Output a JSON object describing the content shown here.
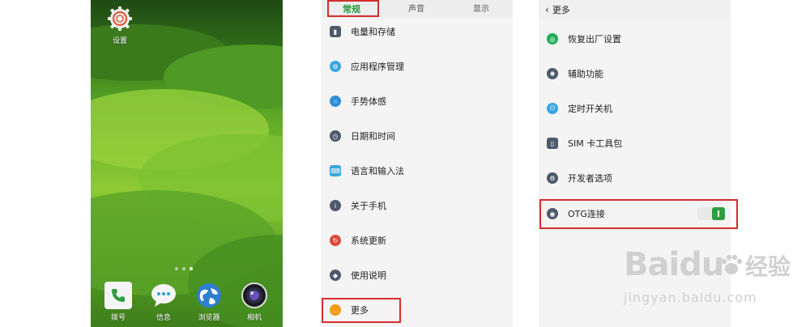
{
  "home": {
    "top_app": {
      "label": "设置",
      "icon": "gear-icon"
    },
    "dock": [
      {
        "label": "拨号",
        "icon": "phone-icon"
      },
      {
        "label": "信息",
        "icon": "message-icon"
      },
      {
        "label": "浏览器",
        "icon": "globe-icon"
      },
      {
        "label": "相机",
        "icon": "camera-icon"
      }
    ],
    "page_dots": 3,
    "active_dot": 3
  },
  "settings": {
    "tabs": [
      {
        "label": "常规",
        "active": true
      },
      {
        "label": "声音",
        "active": false
      },
      {
        "label": "显示",
        "active": false
      }
    ],
    "items": [
      {
        "label": "电量和存储",
        "icon": "battery-icon",
        "color": "#4d5a6b"
      },
      {
        "label": "应用程序管理",
        "icon": "apps-icon",
        "color": "#3aa6e0"
      },
      {
        "label": "手势体感",
        "icon": "gesture-icon",
        "color": "#2f8fd8"
      },
      {
        "label": "日期和时间",
        "icon": "clock-icon",
        "color": "#4d5a6b"
      },
      {
        "label": "语言和输入法",
        "icon": "keyboard-icon",
        "color": "#3aa6e0"
      },
      {
        "label": "关于手机",
        "icon": "info-icon",
        "color": "#4d5a6b"
      },
      {
        "label": "系统更新",
        "icon": "update-icon",
        "color": "#e0483a"
      },
      {
        "label": "使用说明",
        "icon": "bulb-icon",
        "color": "#4d5a6b"
      },
      {
        "label": "更多",
        "icon": "more-icon",
        "color": "#f59a14"
      }
    ]
  },
  "more": {
    "back_label": "更多",
    "items": [
      {
        "label": "恢复出厂设置",
        "icon": "reset-icon",
        "color": "#1fae5a"
      },
      {
        "label": "辅助功能",
        "icon": "accessibility-icon",
        "color": "#4d5a6b"
      },
      {
        "label": "定时开关机",
        "icon": "power-timer-icon",
        "color": "#3aa6e0"
      },
      {
        "label": "SIM 卡工具包",
        "icon": "sim-icon",
        "color": "#4d5a6b"
      },
      {
        "label": "开发者选项",
        "icon": "developer-icon",
        "color": "#4d5a6b"
      },
      {
        "label": "OTG连接",
        "icon": "usb-icon",
        "color": "#4d5a6b",
        "toggle_on": true
      }
    ]
  },
  "watermark": {
    "brand": "Baidu",
    "brand_cn": "经验",
    "url": "jingyan.baidu.com"
  },
  "colors": {
    "accent": "#2e9c3f",
    "highlight": "#d42d2d"
  }
}
